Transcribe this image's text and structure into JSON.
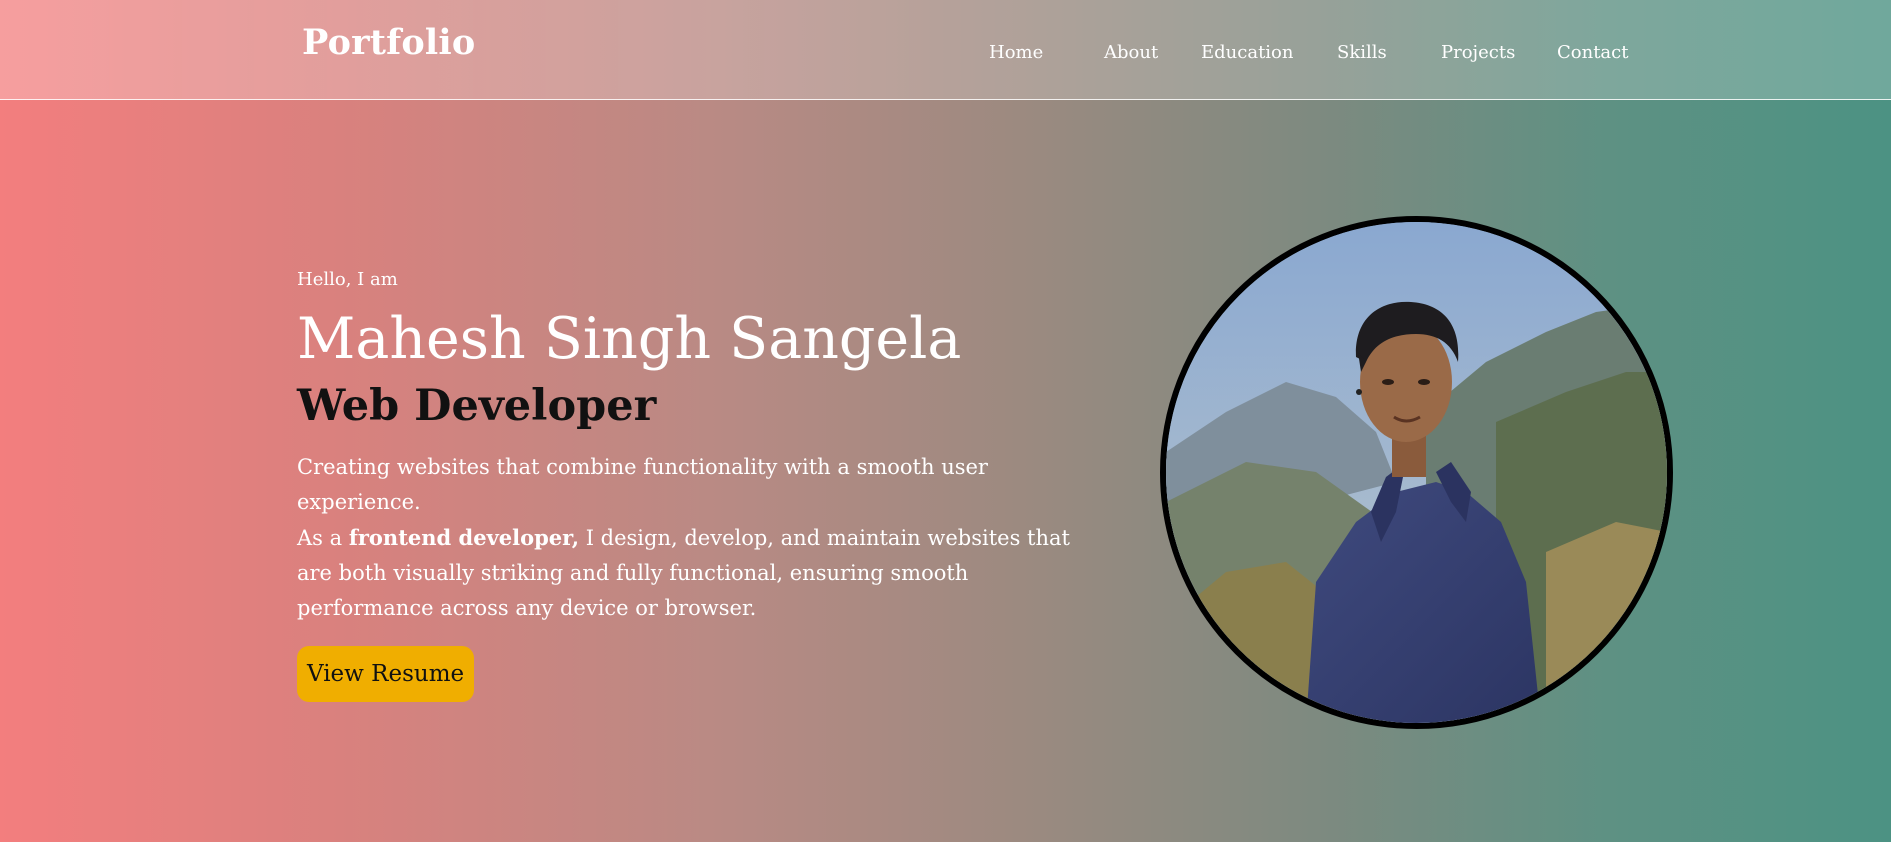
{
  "brand": {
    "logo": "Portfolio"
  },
  "nav": {
    "items": [
      {
        "label": "Home"
      },
      {
        "label": "About"
      },
      {
        "label": "Education"
      },
      {
        "label": "Skills"
      },
      {
        "label": "Projects"
      },
      {
        "label": "Contact"
      }
    ]
  },
  "hero": {
    "greeting": "Hello, I am",
    "name": "Mahesh Singh Sangela",
    "role": "Web Developer",
    "description_line1": "Creating websites that combine functionality with a smooth user experience.",
    "description_prefix": "As a ",
    "description_bold": "frontend developer,",
    "description_suffix": " I design, develop, and maintain websites that are both visually striking and fully functional, ensuring smooth performance across any device or browser.",
    "cta_label": "View Resume"
  },
  "colors": {
    "accent": "#f0ae00",
    "gradient_start": "#f37e7e",
    "gradient_end": "#4c9283"
  }
}
